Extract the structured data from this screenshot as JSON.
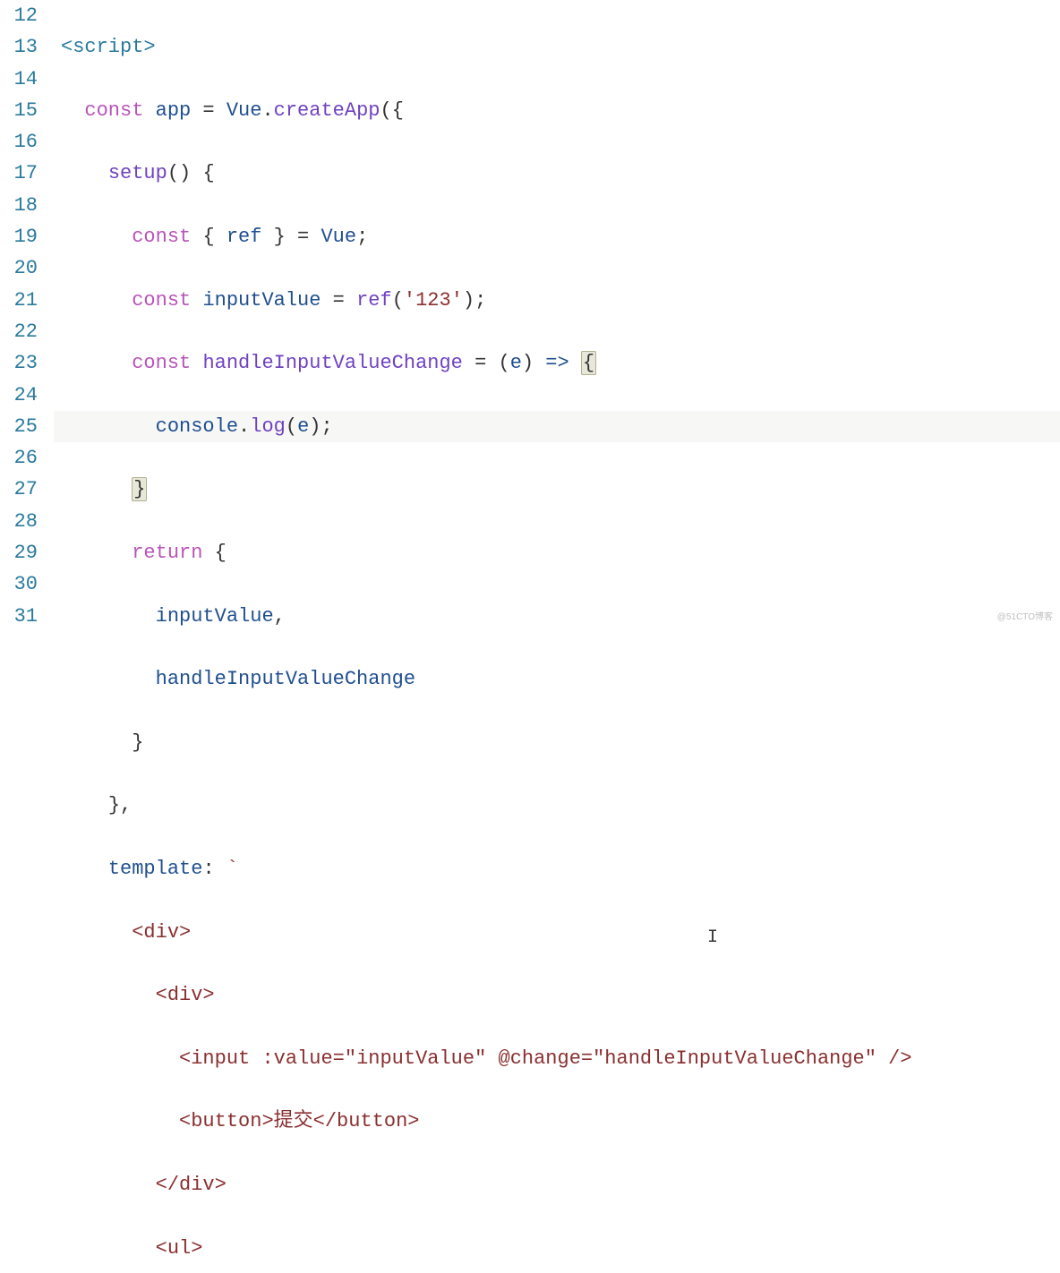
{
  "startLine": 12,
  "watermark": "@51CTO博客",
  "tokens": {
    "script_open": "<script>",
    "const": "const",
    "app": "app",
    "eq": " = ",
    "Vue": "Vue",
    "dot": ".",
    "createApp": "createApp",
    "lparen": "(",
    "rparen": ")",
    "lbrace": "{",
    "rbrace": "}",
    "setup": "setup",
    "empty_parens": "()",
    "ref": "ref",
    "semi": ";",
    "inputValue": "inputValue",
    "ref_call": "ref",
    "str123": "'123'",
    "handleInputValueChange": "handleInputValueChange",
    "e": "e",
    "arrow": " => ",
    "console": "console",
    "log": "log",
    "return": "return",
    "comma": ",",
    "template": "template",
    "colon": ":",
    "backtick": "`",
    "div_open": "<div>",
    "div_close": "</div>",
    "input_line": "<input :value=\"inputValue\" @change=\"handleInputValueChange\" />",
    "button_line": "<button>提交</button>",
    "ul_open": "<ul>"
  }
}
